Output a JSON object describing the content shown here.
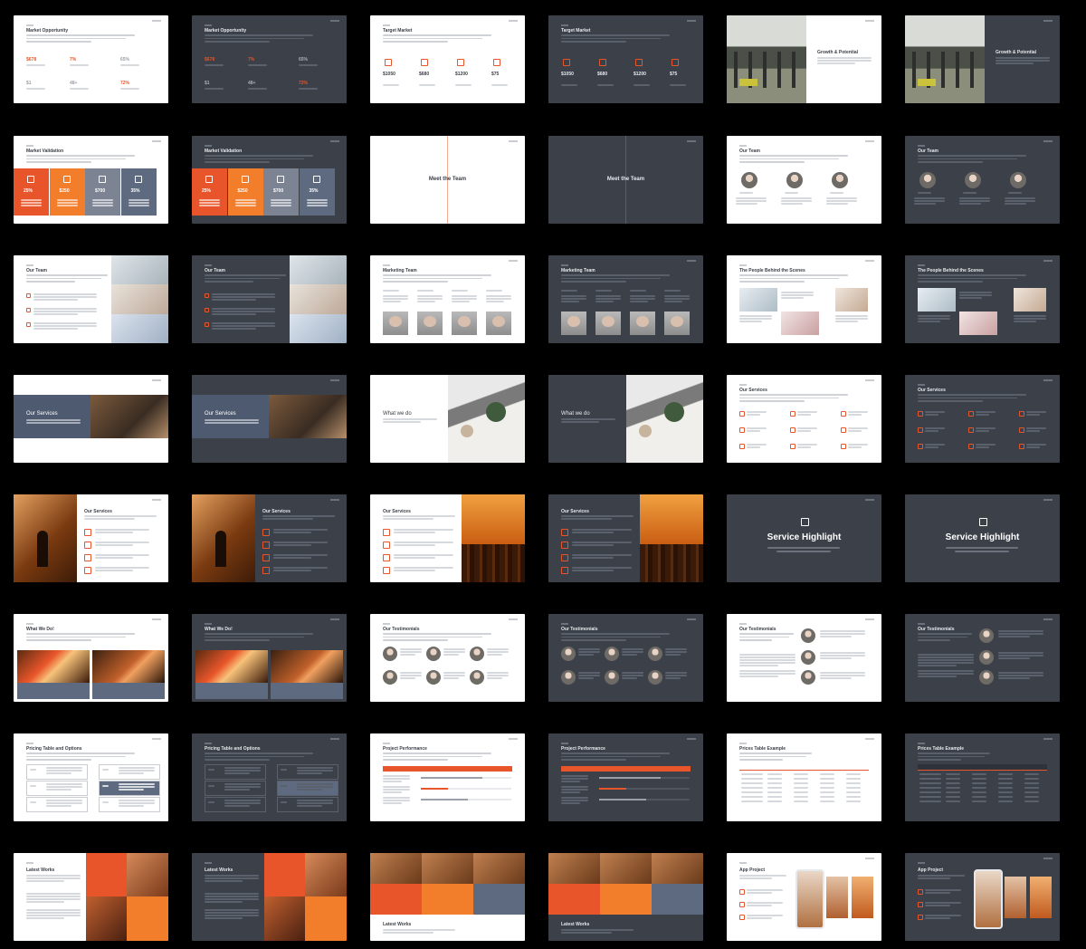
{
  "theme": {
    "orange": "#e8552a",
    "dark": "#3b4049",
    "accent_blue": "#5d6a80"
  },
  "slides": {
    "market_opportunity": {
      "title": "Market Opportunity",
      "stats": [
        "$678",
        "7%",
        "65%",
        "$1",
        "48+",
        "72%"
      ]
    },
    "target_market": {
      "title": "Target Market",
      "values": [
        "$1050",
        "$680",
        "$1200",
        "$75"
      ]
    },
    "growth": {
      "title": "Growth & Potential"
    },
    "market_validation": {
      "title": "Market Validation",
      "values": [
        "25%",
        "$250",
        "$700",
        "35%"
      ]
    },
    "meet_team": {
      "title": "Meet the Team"
    },
    "our_team": {
      "title": "Our Team"
    },
    "marketing_team": {
      "title": "Marketing Team"
    },
    "people_behind": {
      "title": "The People Behind the Scenes"
    },
    "our_services": {
      "title": "Our Services"
    },
    "what_we_do": {
      "title": "What we do"
    },
    "service_highlight": {
      "title": "Service Highlight"
    },
    "what_we_do2": {
      "title": "What We Do!"
    },
    "testimonials": {
      "title": "Our Testimonials"
    },
    "pricing_options": {
      "title": "Pricing Table and Options"
    },
    "project_performance": {
      "title": "Project Performance"
    },
    "prices_table": {
      "title": "Prices Table Example"
    },
    "latest_works": {
      "title": "Latest Works"
    },
    "app_project": {
      "title": "App Project"
    }
  }
}
